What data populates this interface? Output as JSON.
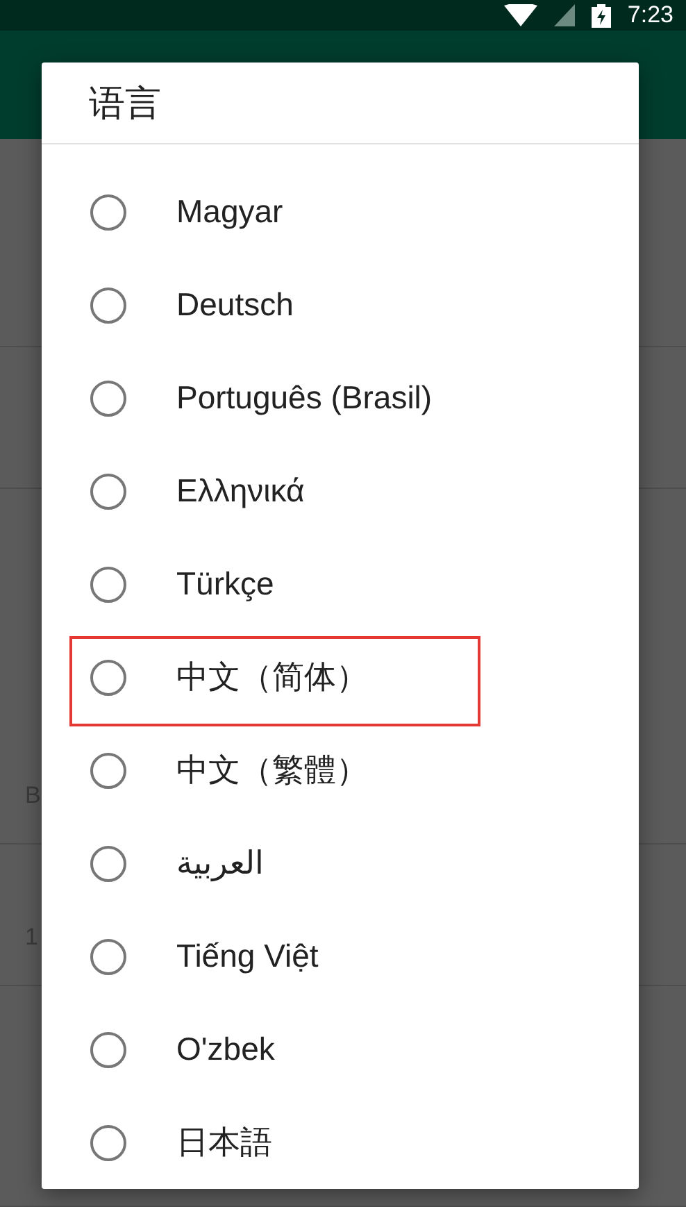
{
  "status_bar": {
    "time": "7:23"
  },
  "background_rows": [
    {
      "subtitle": null,
      "title": null
    },
    {
      "subtitle": null,
      "title": null
    },
    {
      "subtitle": "B",
      "title": null
    },
    {
      "subtitle": "1",
      "title": null
    },
    {
      "subtitle": null,
      "title": null
    }
  ],
  "dialog": {
    "title": "语言",
    "options": [
      {
        "label": "Magyar",
        "selected": false,
        "highlighted": false
      },
      {
        "label": "Deutsch",
        "selected": false,
        "highlighted": false
      },
      {
        "label": "Português (Brasil)",
        "selected": false,
        "highlighted": false
      },
      {
        "label": "Ελληνικά",
        "selected": false,
        "highlighted": false
      },
      {
        "label": "Türkçe",
        "selected": false,
        "highlighted": false
      },
      {
        "label": "中文（简体）",
        "selected": false,
        "highlighted": true
      },
      {
        "label": "中文（繁體）",
        "selected": false,
        "highlighted": false
      },
      {
        "label": "العربية",
        "selected": false,
        "highlighted": false
      },
      {
        "label": "Tiếng Việt",
        "selected": false,
        "highlighted": false
      },
      {
        "label": "O'zbek",
        "selected": false,
        "highlighted": false
      },
      {
        "label": "日本語",
        "selected": false,
        "highlighted": false
      }
    ]
  }
}
